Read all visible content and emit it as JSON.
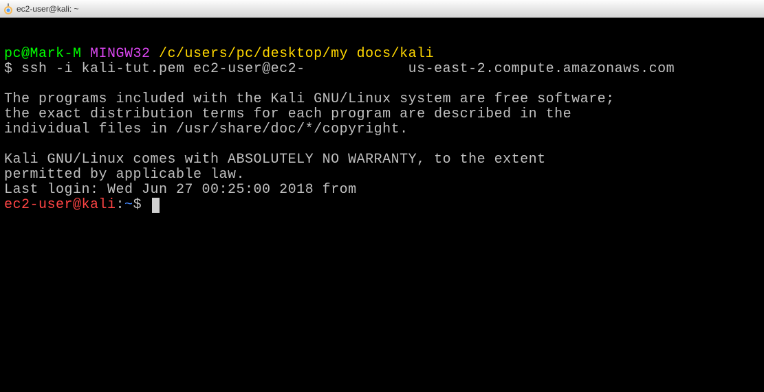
{
  "window": {
    "title": "ec2-user@kali: ~"
  },
  "terminal": {
    "prompt1_user": "pc@Mark-M",
    "prompt1_env": " MINGW32",
    "prompt1_path": " /c/users/pc/desktop/my docs/kali",
    "prompt2_dollar": "$ ",
    "command": "ssh -i kali-tut.pem ec2-user@ec2-            us-east-2.compute.amazonaws.com",
    "motd1": "The programs included with the Kali GNU/Linux system are free software;",
    "motd2": "the exact distribution terms for each program are described in the",
    "motd3": "individual files in /usr/share/doc/*/copyright.",
    "motd4": "Kali GNU/Linux comes with ABSOLUTELY NO WARRANTY, to the extent",
    "motd5": "permitted by applicable law.",
    "lastlogin": "Last login: Wed Jun 27 00:25:00 2018 from",
    "remote_user": "ec2-user@kali",
    "remote_colon": ":",
    "remote_path": "~",
    "remote_dollar": "$ "
  }
}
